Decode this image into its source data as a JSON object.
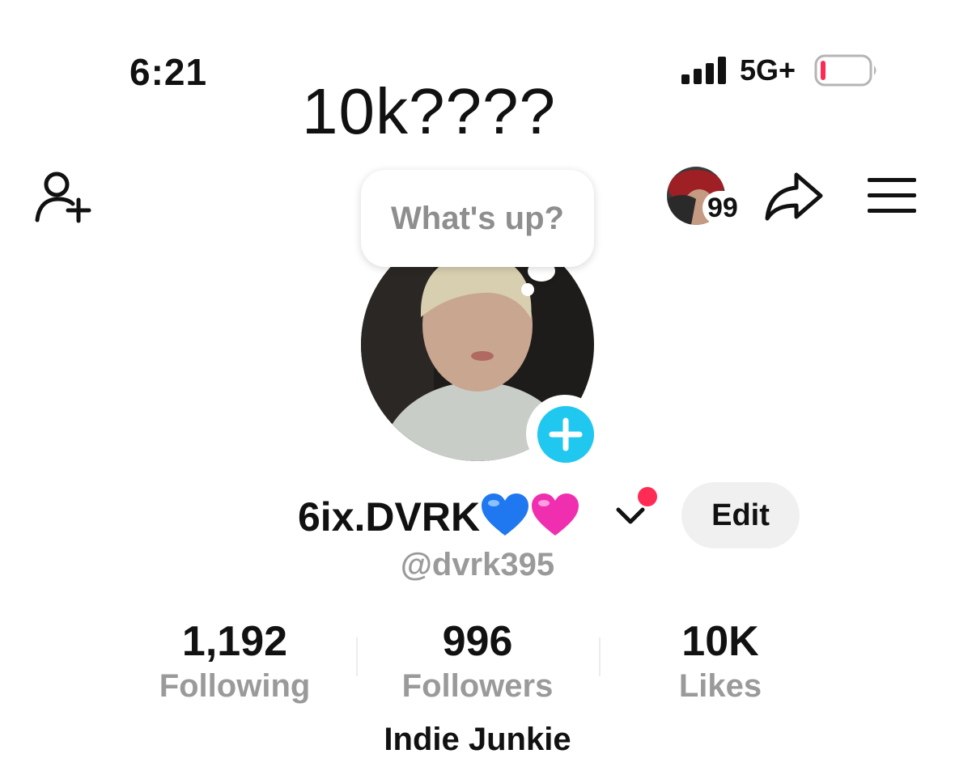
{
  "status_bar": {
    "time": "6:21",
    "network": "5G+",
    "battery_level": 0.1,
    "signal_bars": 4
  },
  "overlay_caption": "10k????",
  "nav": {
    "add_friend_icon": "person-add-icon",
    "inbox_badge": "99",
    "share_icon": "share-arrow-icon",
    "menu_icon": "hamburger-menu-icon"
  },
  "status_bubble": {
    "text": "What's up?"
  },
  "profile": {
    "display_name": "6ix.DVRK",
    "name_emojis": [
      "blue-heart-icon",
      "pink-heart-icon"
    ],
    "handle": "@dvrk395",
    "edit_label": "Edit",
    "bio": "Indie Junkie"
  },
  "stats": [
    {
      "value": "1,192",
      "label": "Following"
    },
    {
      "value": "996",
      "label": "Followers"
    },
    {
      "value": "10K",
      "label": "Likes"
    }
  ],
  "colors": {
    "accent_cyan": "#20c8f0",
    "notification_red": "#fe2c55",
    "muted_gray": "#9a9a9a",
    "edit_bg": "#f0f0f0"
  }
}
